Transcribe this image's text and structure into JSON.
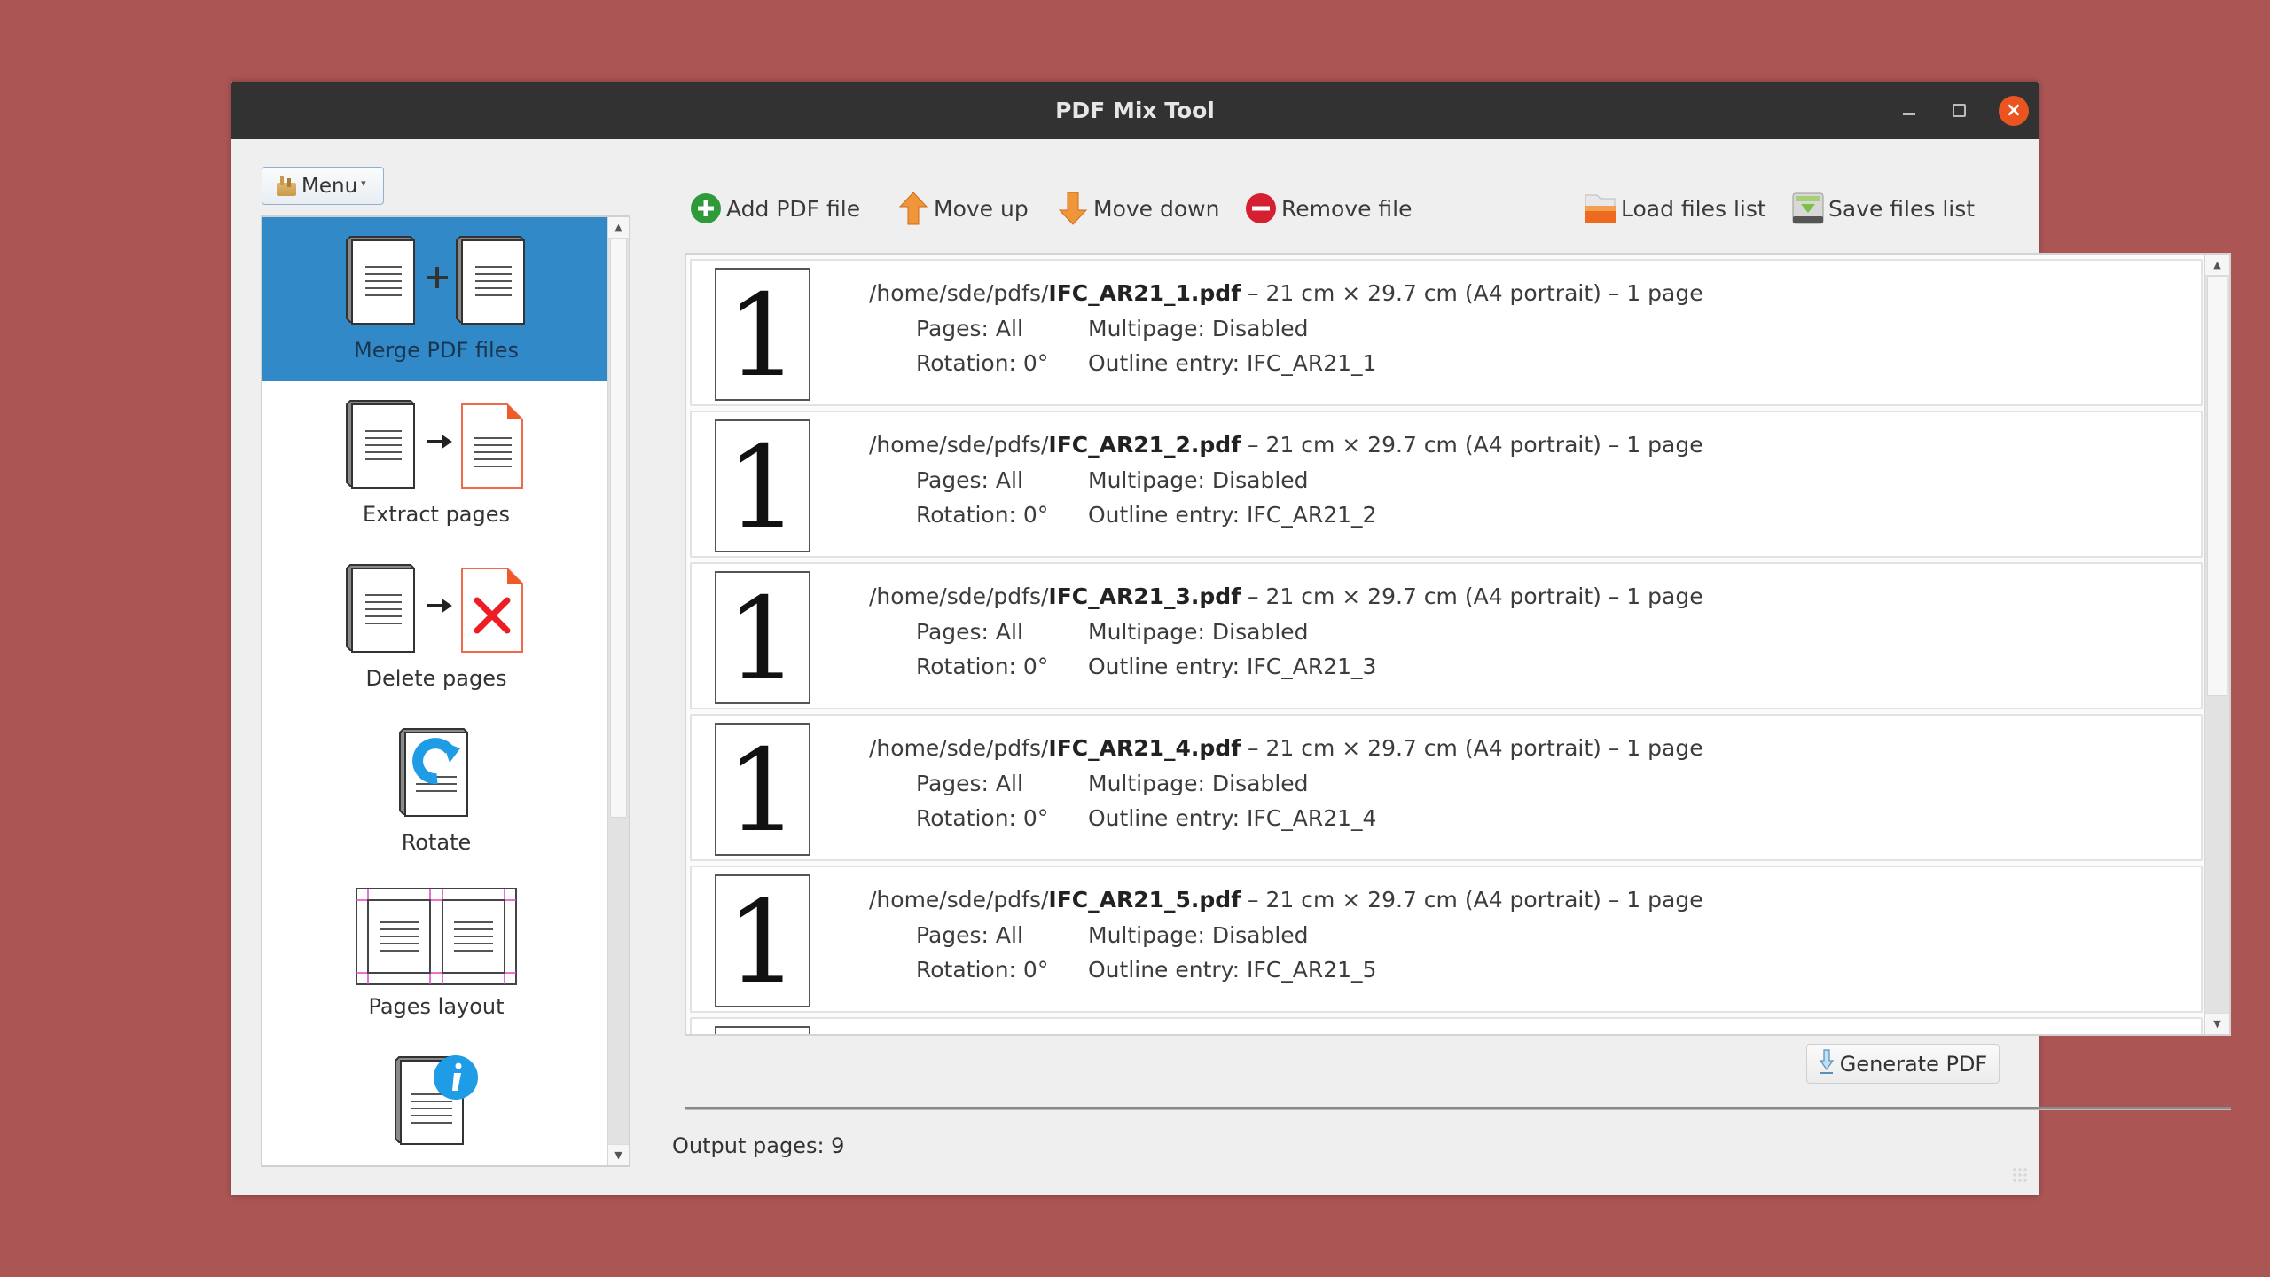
{
  "window": {
    "title": "PDF Mix Tool",
    "controls": {
      "minimize_icon": "minimize-icon",
      "maximize_icon": "maximize-icon",
      "close_icon": "close-icon",
      "close_color": "#e95420"
    }
  },
  "menu": {
    "label": "Menu",
    "icon": "app-menu-icon"
  },
  "sidebar": {
    "selected_color": "#3289c8",
    "items": [
      {
        "label": "Merge PDF files",
        "icon": "merge-pdf-icon",
        "selected": true
      },
      {
        "label": "Extract pages",
        "icon": "extract-pages-icon",
        "selected": false
      },
      {
        "label": "Delete pages",
        "icon": "delete-pages-icon",
        "selected": false
      },
      {
        "label": "Rotate",
        "icon": "rotate-icon",
        "selected": false
      },
      {
        "label": "Pages layout",
        "icon": "pages-layout-icon",
        "selected": false
      },
      {
        "label": "",
        "icon": "document-info-icon",
        "selected": false
      }
    ],
    "scroll": {
      "visible_fraction": 0.64,
      "position": 0
    }
  },
  "toolbar": {
    "add": {
      "label": "Add PDF file",
      "icon": "add-icon"
    },
    "move_up": {
      "label": "Move up",
      "icon": "arrow-up-icon"
    },
    "move_down": {
      "label": "Move down",
      "icon": "arrow-down-icon"
    },
    "remove": {
      "label": "Remove file",
      "icon": "remove-icon"
    },
    "load": {
      "label": "Load files list",
      "icon": "folder-open-icon"
    },
    "save": {
      "label": "Save files list",
      "icon": "save-drive-icon"
    }
  },
  "files": [
    {
      "thumb": "1",
      "dir": "/home/sde/pdfs/",
      "name": "IFC_AR21_1.pdf",
      "details": " – 21 cm × 29.7 cm (A4 portrait) – 1 page",
      "pages": "Pages: All",
      "multipage": "Multipage: Disabled",
      "rotation": "Rotation: 0°",
      "outline": "Outline entry: IFC_AR21_1"
    },
    {
      "thumb": "1",
      "dir": "/home/sde/pdfs/",
      "name": "IFC_AR21_2.pdf",
      "details": " – 21 cm × 29.7 cm (A4 portrait) – 1 page",
      "pages": "Pages: All",
      "multipage": "Multipage: Disabled",
      "rotation": "Rotation: 0°",
      "outline": "Outline entry: IFC_AR21_2"
    },
    {
      "thumb": "1",
      "dir": "/home/sde/pdfs/",
      "name": "IFC_AR21_3.pdf",
      "details": " – 21 cm × 29.7 cm (A4 portrait) – 1 page",
      "pages": "Pages: All",
      "multipage": "Multipage: Disabled",
      "rotation": "Rotation: 0°",
      "outline": "Outline entry: IFC_AR21_3"
    },
    {
      "thumb": "1",
      "dir": "/home/sde/pdfs/",
      "name": "IFC_AR21_4.pdf",
      "details": " – 21 cm × 29.7 cm (A4 portrait) – 1 page",
      "pages": "Pages: All",
      "multipage": "Multipage: Disabled",
      "rotation": "Rotation: 0°",
      "outline": "Outline entry: IFC_AR21_4"
    },
    {
      "thumb": "1",
      "dir": "/home/sde/pdfs/",
      "name": "IFC_AR21_5.pdf",
      "details": " – 21 cm × 29.7 cm (A4 portrait) – 1 page",
      "pages": "Pages: All",
      "multipage": "Multipage: Disabled",
      "rotation": "Rotation: 0°",
      "outline": "Outline entry: IFC_AR21_5"
    }
  ],
  "filelist_scroll": {
    "visible_fraction": 0.57,
    "position": 0
  },
  "generate": {
    "label": "Generate PDF",
    "icon": "generate-pdf-icon"
  },
  "status": {
    "output_pages": "Output pages: 9"
  }
}
